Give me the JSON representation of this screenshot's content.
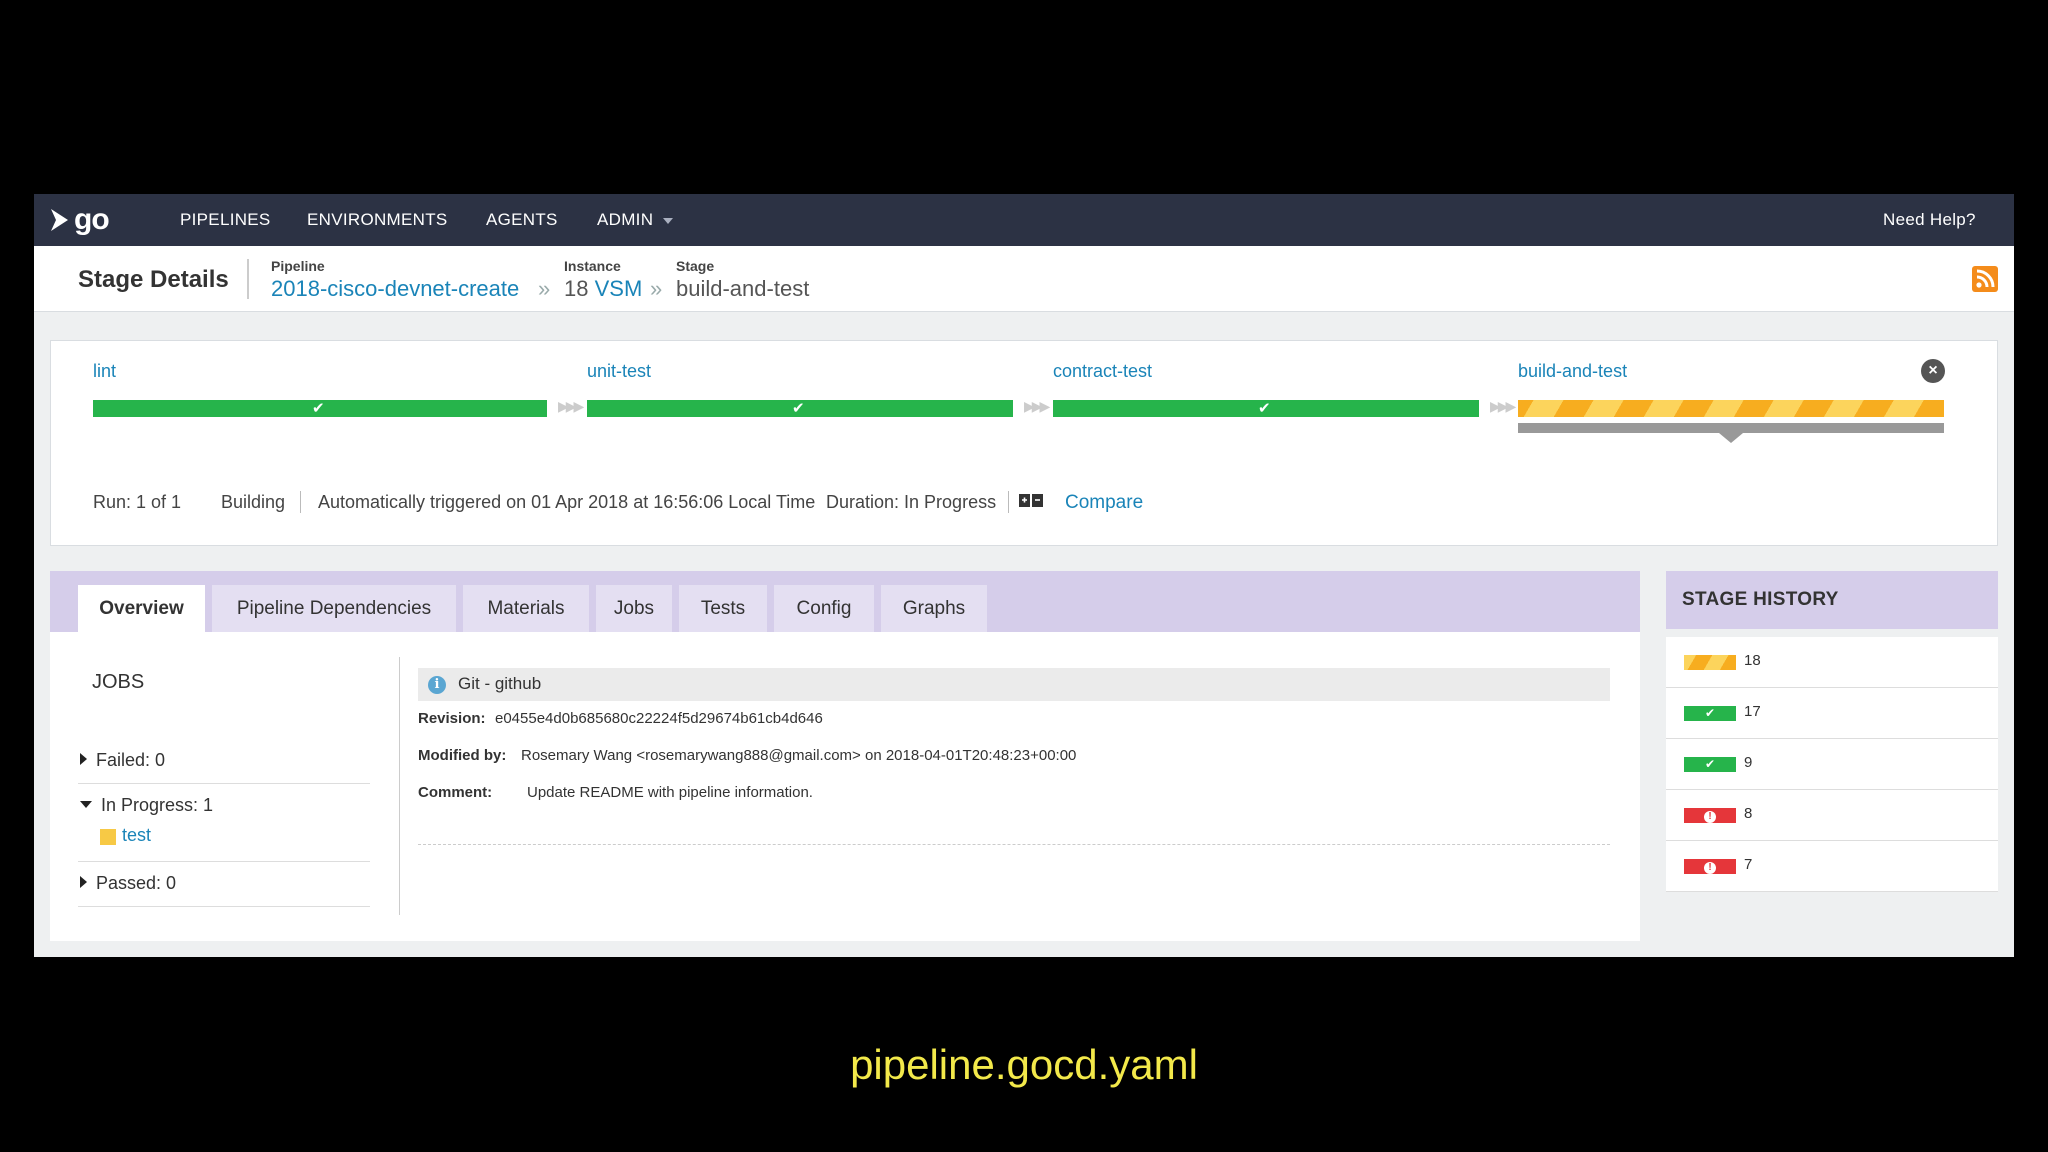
{
  "app": {
    "logo_text": "go"
  },
  "nav": {
    "pipelines": "PIPELINES",
    "environments": "ENVIRONMENTS",
    "agents": "AGENTS",
    "admin": "ADMIN",
    "help": "Need Help?"
  },
  "header": {
    "title": "Stage Details",
    "pipeline_label": "Pipeline",
    "pipeline_value": "2018-cisco-devnet-create",
    "instance_label": "Instance",
    "instance_number": "18",
    "instance_link": "VSM",
    "stage_label": "Stage",
    "stage_value": "build-and-test",
    "separator": "»",
    "rss_icon": "rss-feed-icon"
  },
  "stages": [
    {
      "name": "lint",
      "status": "passed",
      "color": "#26b44b"
    },
    {
      "name": "unit-test",
      "status": "passed",
      "color": "#26b44b"
    },
    {
      "name": "contract-test",
      "status": "passed",
      "color": "#26b44b"
    },
    {
      "name": "build-and-test",
      "status": "building",
      "color": "#f7ad1f"
    }
  ],
  "run_info": {
    "run": "Run: 1 of 1",
    "status": "Building",
    "trigger": "Automatically triggered on 01 Apr 2018 at 16:56:06 Local Time",
    "duration": "Duration: In Progress",
    "compare": "Compare"
  },
  "tabs": [
    "Overview",
    "Pipeline Dependencies",
    "Materials",
    "Jobs",
    "Tests",
    "Config",
    "Graphs"
  ],
  "jobs": {
    "title": "JOBS",
    "failed": "Failed: 0",
    "in_progress": "In Progress: 1",
    "in_progress_job": "test",
    "passed": "Passed: 0"
  },
  "material": {
    "name": "Git - github",
    "revision_label": "Revision:",
    "revision": "e0455e4d0b685680c22224f5d29674b61cb4d646",
    "modified_label": "Modified by:",
    "modified": "Rosemary Wang <rosemarywang888@gmail.com> on 2018-04-01T20:48:23+00:00",
    "comment_label": "Comment:",
    "comment": "Update README with pipeline information."
  },
  "history": {
    "title": "STAGE HISTORY",
    "items": [
      {
        "label": "18",
        "status": "building"
      },
      {
        "label": "17",
        "status": "passed"
      },
      {
        "label": "9",
        "status": "passed"
      },
      {
        "label": "8",
        "status": "failed"
      },
      {
        "label": "7",
        "status": "failed"
      }
    ]
  },
  "caption": "pipeline.gocd.yaml"
}
